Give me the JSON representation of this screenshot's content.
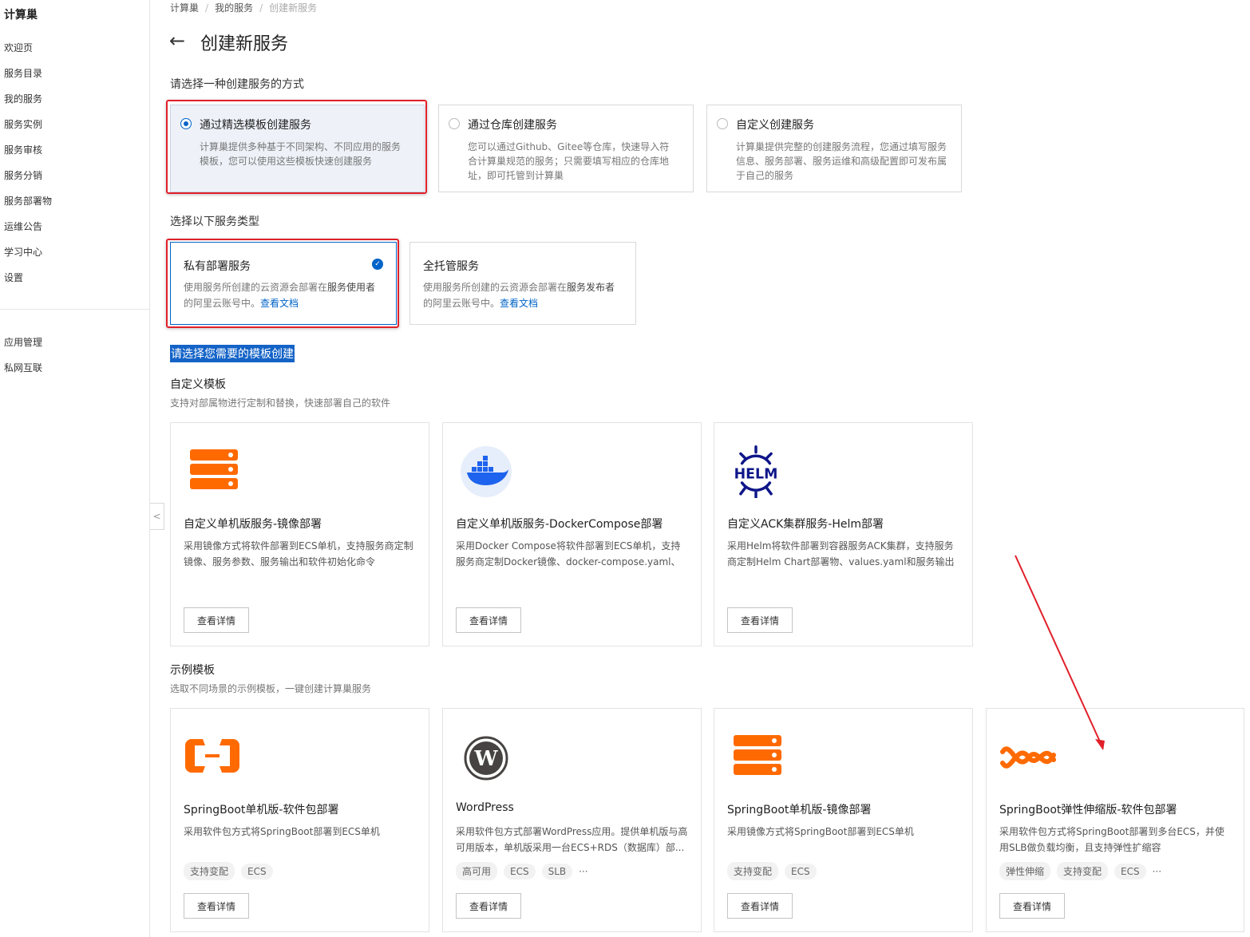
{
  "sidebar": {
    "brand": "计算巢",
    "items": [
      "欢迎页",
      "服务目录",
      "我的服务",
      "服务实例",
      "服务审核",
      "服务分销",
      "服务部署物",
      "运维公告",
      "学习中心",
      "设置"
    ],
    "items2": [
      "应用管理",
      "私网互联"
    ]
  },
  "breadcrumb": [
    "计算巢",
    "我的服务",
    "创建新服务"
  ],
  "page_title": "创建新服务",
  "method_section": {
    "label": "请选择一种创建服务的方式",
    "options": [
      {
        "title": "通过精选模板创建服务",
        "desc": "计算巢提供多种基于不同架构、不同应用的服务模板，您可以使用这些模板快速创建服务",
        "selected": true
      },
      {
        "title": "通过仓库创建服务",
        "desc": "您可以通过Github、Gitee等仓库，快速导入符合计算巢规范的服务；只需要填写相应的仓库地址，即可托管到计算巢",
        "selected": false
      },
      {
        "title": "自定义创建服务",
        "desc": "计算巢提供完整的创建服务流程，您通过填写服务信息、服务部署、服务运维和高级配置即可发布属于自己的服务",
        "selected": false
      }
    ]
  },
  "type_section": {
    "label": "选择以下服务类型",
    "options": [
      {
        "title": "私有部署服务",
        "desc_pre": "使用服务所创建的云资源会部署在",
        "desc_bold": "服务使用者",
        "desc_post": "的阿里云账号中。",
        "link": "查看文档",
        "selected": true
      },
      {
        "title": "全托管服务",
        "desc_pre": "使用服务所创建的云资源会部署在",
        "desc_bold": "服务发布者",
        "desc_post": "的阿里云账号中。",
        "link": "查看文档",
        "selected": false
      }
    ]
  },
  "highlight": "请选择您需要的模板创建",
  "custom_group": {
    "title": "自定义模板",
    "subtitle": "支持对部属物进行定制和替换，快速部署自己的软件",
    "cards": [
      {
        "icon": "server-stack-icon",
        "name": "自定义单机版服务-镜像部署",
        "desc": "采用镜像方式将软件部署到ECS单机，支持服务商定制镜像、服务参数、服务输出和软件初始化命令",
        "button": "查看详情"
      },
      {
        "icon": "docker-whale-icon",
        "name": "自定义单机版服务-DockerCompose部署",
        "desc": "采用Docker Compose将软件部署到ECS单机，支持服务商定制Docker镜像、docker-compose.yaml、服...",
        "button": "查看详情"
      },
      {
        "icon": "helm-icon",
        "name": "自定义ACK集群服务-Helm部署",
        "desc": "采用Helm将软件部署到容器服务ACK集群，支持服务商定制Helm Chart部署物、values.yaml和服务输出",
        "button": "查看详情"
      }
    ]
  },
  "example_group": {
    "title": "示例模板",
    "subtitle": "选取不同场景的示例模板，一键创建计算巢服务",
    "cards": [
      {
        "icon": "aliyun-logo-icon",
        "name": "SpringBoot单机版-软件包部署",
        "desc": "采用软件包方式将SpringBoot部署到ECS单机",
        "tags": [
          "支持变配",
          "ECS"
        ],
        "more": "",
        "button": "查看详情"
      },
      {
        "icon": "wordpress-icon",
        "name": "WordPress",
        "desc": "采用软件包方式部署WordPress应用。提供单机版与高可用版本，单机版采用一台ECS+RDS（数据库）部...",
        "tags": [
          "高可用",
          "ECS",
          "SLB"
        ],
        "more": "···",
        "button": "查看详情"
      },
      {
        "icon": "server-stack-icon",
        "name": "SpringBoot单机版-镜像部署",
        "desc": "采用镜像方式将SpringBoot部署到ECS单机",
        "tags": [
          "支持变配",
          "ECS"
        ],
        "more": "",
        "button": "查看详情"
      },
      {
        "icon": "elastic-wave-icon",
        "name": "SpringBoot弹性伸缩版-软件包部署",
        "desc": "采用软件包方式将SpringBoot部署到多台ECS，并使用SLB做负载均衡，且支持弹性扩缩容",
        "tags": [
          "弹性伸缩",
          "支持变配",
          "ECS"
        ],
        "more": "···",
        "button": "查看详情"
      }
    ]
  },
  "colors": {
    "accent": "#0064c8",
    "annotation_red": "#e0202a",
    "icon_orange": "#ff6a00",
    "helm_navy": "#0f1689"
  }
}
